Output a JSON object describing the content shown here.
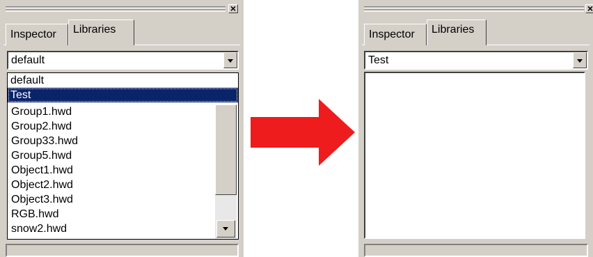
{
  "left_panel": {
    "close_glyph": "×",
    "tabs": [
      {
        "label": "Inspector"
      },
      {
        "label": "Libraries"
      }
    ],
    "combo": {
      "selected": "default"
    },
    "dropdown": {
      "options": [
        {
          "label": "default"
        },
        {
          "label": "Test"
        }
      ],
      "highlighted": "Test"
    },
    "files": [
      "Group1.hwd",
      "Group2.hwd",
      "Group33.hwd",
      "Group5.hwd",
      "Object1.hwd",
      "Object2.hwd",
      "Object3.hwd",
      "RGB.hwd",
      "snow2.hwd"
    ]
  },
  "right_panel": {
    "close_glyph": "×",
    "tabs": [
      {
        "label": "Inspector"
      },
      {
        "label": "Libraries"
      }
    ],
    "combo": {
      "selected": "Test"
    }
  },
  "arrow_color": "#ee1c1c",
  "active_tab": "Libraries"
}
